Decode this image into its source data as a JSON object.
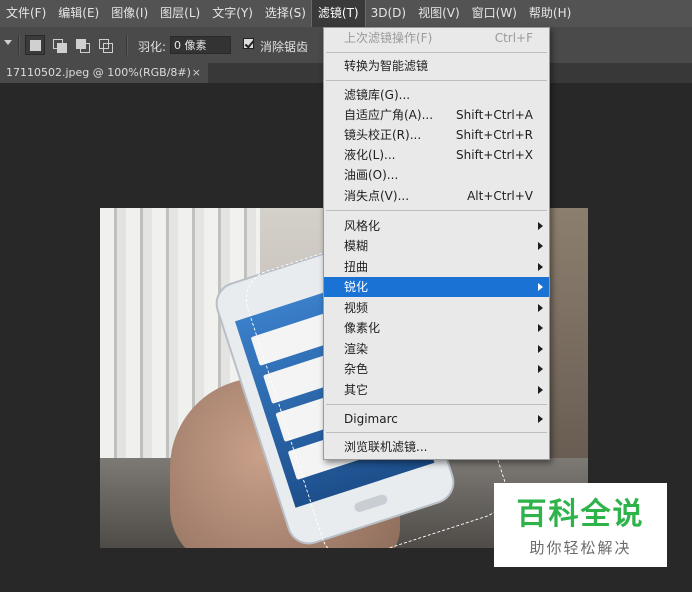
{
  "menubar": {
    "items": [
      {
        "label": "文件(F)"
      },
      {
        "label": "编辑(E)"
      },
      {
        "label": "图像(I)"
      },
      {
        "label": "图层(L)"
      },
      {
        "label": "文字(Y)"
      },
      {
        "label": "选择(S)"
      },
      {
        "label": "滤镜(T)"
      },
      {
        "label": "3D(D)"
      },
      {
        "label": "视图(V)"
      },
      {
        "label": "窗口(W)"
      },
      {
        "label": "帮助(H)"
      }
    ],
    "active_index": 6
  },
  "options_bar": {
    "feather_label": "羽化:",
    "feather_value": "0 像素",
    "antialias_label": "消除锯齿",
    "antialias_checked": true
  },
  "document_tab": {
    "title": "17110502.jpeg @ 100%(RGB/8#)",
    "close_glyph": "×"
  },
  "filter_menu": {
    "last_filter": {
      "label": "上次滤镜操作(F)",
      "shortcut": "Ctrl+F"
    },
    "convert_smart": {
      "label": "转换为智能滤镜"
    },
    "group1": [
      {
        "label": "滤镜库(G)...",
        "shortcut": ""
      },
      {
        "label": "自适应广角(A)...",
        "shortcut": "Shift+Ctrl+A"
      },
      {
        "label": "镜头校正(R)...",
        "shortcut": "Shift+Ctrl+R"
      },
      {
        "label": "液化(L)...",
        "shortcut": "Shift+Ctrl+X"
      },
      {
        "label": "油画(O)...",
        "shortcut": ""
      },
      {
        "label": "消失点(V)...",
        "shortcut": "Alt+Ctrl+V"
      }
    ],
    "group2": [
      {
        "label": "风格化"
      },
      {
        "label": "模糊"
      },
      {
        "label": "扭曲"
      },
      {
        "label": "锐化"
      },
      {
        "label": "视频"
      },
      {
        "label": "像素化"
      },
      {
        "label": "渲染"
      },
      {
        "label": "杂色"
      },
      {
        "label": "其它"
      }
    ],
    "highlighted": "锐化",
    "digimarc": {
      "label": "Digimarc"
    },
    "browse": {
      "label": "浏览联机滤镜..."
    }
  },
  "watermark": {
    "title": "百科全说",
    "subtitle": "助你轻松解决"
  },
  "colors": {
    "menubar_bg": "#535353",
    "workspace_bg": "#282828",
    "menu_bg": "#e9e9e9",
    "highlight": "#1a72d4",
    "watermark_green": "#2db34a"
  }
}
